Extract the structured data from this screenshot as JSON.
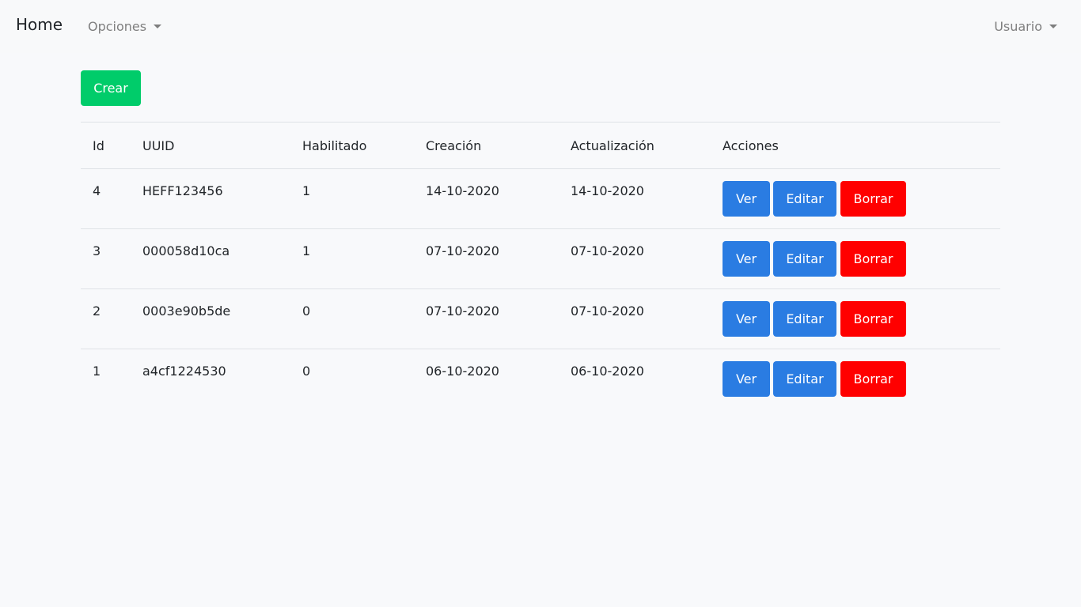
{
  "navbar": {
    "brand": "Home",
    "options_label": "Opciones",
    "user_label": "Usuario"
  },
  "toolbar": {
    "create_label": "Crear"
  },
  "table": {
    "headers": [
      "Id",
      "UUID",
      "Habilitado",
      "Creación",
      "Actualización",
      "Acciones"
    ],
    "rows": [
      {
        "id": "4",
        "uuid": "HEFF123456",
        "enabled": "1",
        "created": "14-10-2020",
        "updated": "14-10-2020"
      },
      {
        "id": "3",
        "uuid": "000058d10ca",
        "enabled": "1",
        "created": "07-10-2020",
        "updated": "07-10-2020"
      },
      {
        "id": "2",
        "uuid": "0003e90b5de",
        "enabled": "0",
        "created": "07-10-2020",
        "updated": "07-10-2020"
      },
      {
        "id": "1",
        "uuid": "a4cf1224530",
        "enabled": "0",
        "created": "06-10-2020",
        "updated": "06-10-2020"
      }
    ],
    "actions": {
      "view_label": "Ver",
      "edit_label": "Editar",
      "delete_label": "Borrar"
    }
  },
  "colors": {
    "create": "#00cc6a",
    "primary": "#2a7ce2",
    "danger": "#ff0000"
  }
}
